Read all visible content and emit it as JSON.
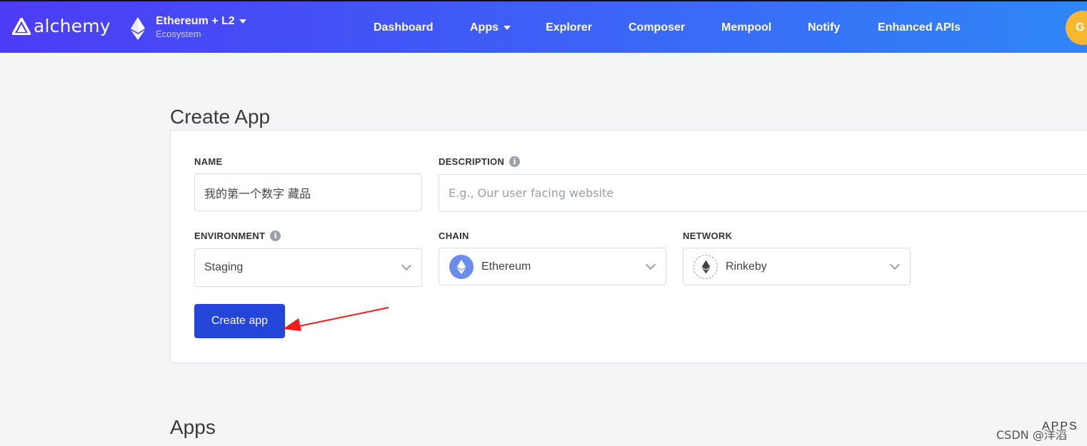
{
  "nav": {
    "logo_text": "alchemy",
    "ecosystem_title": "Ethereum + L2",
    "ecosystem_sub": "Ecosystem",
    "items": [
      "Dashboard",
      "Apps",
      "Explorer",
      "Composer",
      "Mempool",
      "Notify",
      "Enhanced APIs"
    ],
    "avatar_letter": "G"
  },
  "create_app": {
    "title": "Create App",
    "name_label": "NAME",
    "name_value": "我的第一个数字 藏品",
    "description_label": "DESCRIPTION",
    "description_placeholder": "E.g., Our user facing website",
    "environment_label": "ENVIRONMENT",
    "environment_value": "Staging",
    "chain_label": "CHAIN",
    "chain_value": "Ethereum",
    "network_label": "NETWORK",
    "network_value": "Rinkeby",
    "submit_label": "Create app"
  },
  "apps": {
    "title": "Apps",
    "right_label": "APPS"
  },
  "watermark": "CSDN @洋滔",
  "colors": {
    "button": "#2446d8",
    "arrow": "#f21b1b",
    "avatar": "#f7b731"
  }
}
